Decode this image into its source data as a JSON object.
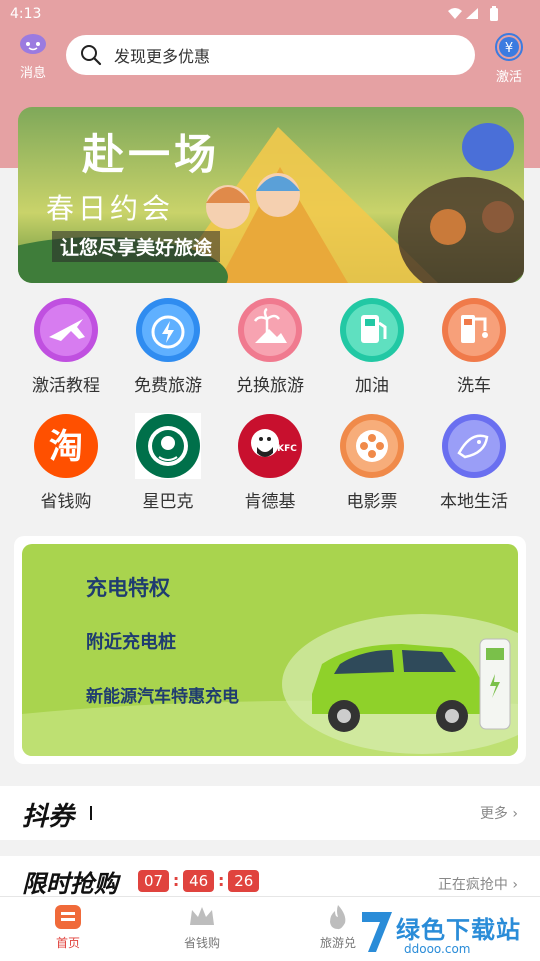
{
  "status_bar": {
    "time": "4:13"
  },
  "header": {
    "messages_label": "消息",
    "search_placeholder": "发现更多优惠",
    "activate_label": "激活"
  },
  "banner": {
    "title": "赴一场",
    "subtitle": "春日约会",
    "tagline": "让您尽享美好旅途"
  },
  "grid": [
    {
      "label": "激活教程",
      "icon": "plane-icon",
      "color": "#c050e0"
    },
    {
      "label": "免费旅游",
      "icon": "lightning-clock-icon",
      "color": "#2f8cf0"
    },
    {
      "label": "兑换旅游",
      "icon": "palm-tree-icon",
      "color": "#f07a8f"
    },
    {
      "label": "加油",
      "icon": "gas-pump-icon",
      "color": "#22c8a4"
    },
    {
      "label": "洗车",
      "icon": "car-wash-icon",
      "color": "#f07a4a"
    },
    {
      "label": "省钱购",
      "icon": "taobao-icon",
      "color": "#ff5000"
    },
    {
      "label": "星巴克",
      "icon": "starbucks-logo-icon",
      "color": "#00704a"
    },
    {
      "label": "肯德基",
      "icon": "kfc-logo-icon",
      "color": "#c8102e"
    },
    {
      "label": "电影票",
      "icon": "film-reel-icon",
      "color": "#f08a4a"
    },
    {
      "label": "本地生活",
      "icon": "fish-icon",
      "color": "#6a6ff0"
    }
  ],
  "grid_logo_text": {
    "starbucks": "STARBUCKS COFFEE",
    "kfc": "KFC"
  },
  "ev_card": {
    "title": "充电特权",
    "line1": "附近充电桩",
    "line2": "新能源汽车特惠充电"
  },
  "douquan": {
    "title": "抖券",
    "more": "更多"
  },
  "flash_sale": {
    "title": "限时抢购",
    "hours": "07",
    "minutes": "46",
    "seconds": "26",
    "status": "正在疯抢中"
  },
  "tabbar": {
    "tabs": [
      {
        "label": "首页",
        "active": true
      },
      {
        "label": "省钱购",
        "active": false
      },
      {
        "label": "旅游兑",
        "active": false
      }
    ]
  },
  "watermark": {
    "brand": "绿色下载站",
    "site": "ddooo.com"
  },
  "colors": {
    "accent": "#e0433e",
    "header_pink": "#e5a1a3",
    "ev_green": "#9fd44a"
  }
}
